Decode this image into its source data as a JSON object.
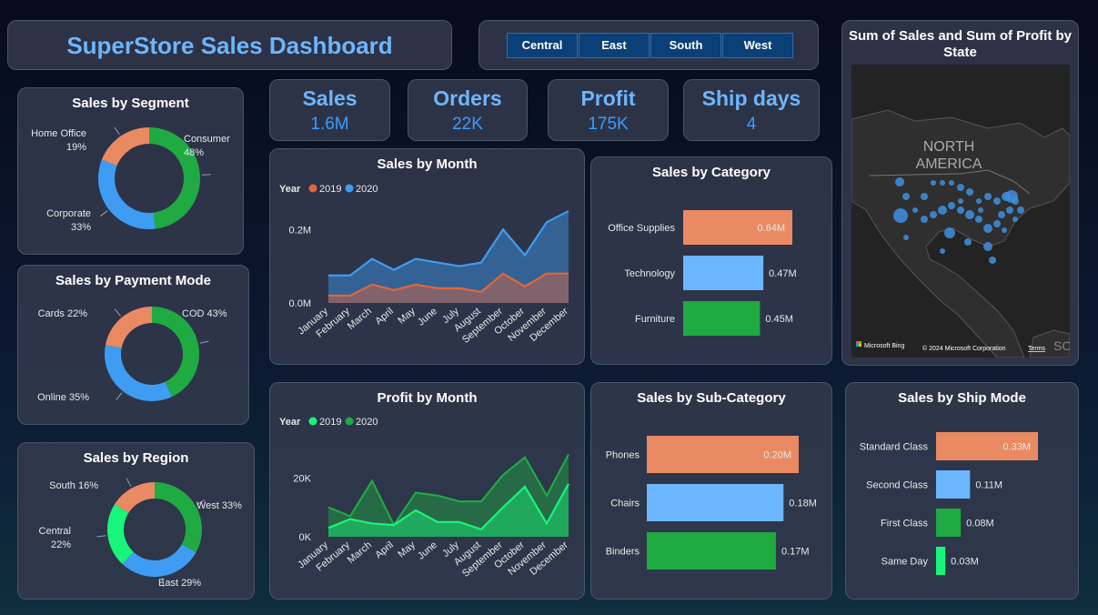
{
  "header": {
    "title": "SuperStore Sales Dashboard"
  },
  "slicer": {
    "options": [
      "Central",
      "East",
      "South",
      "West"
    ]
  },
  "kpis": [
    {
      "label": "Sales",
      "value": "1.6M"
    },
    {
      "label": "Orders",
      "value": "22K"
    },
    {
      "label": "Profit",
      "value": "175K"
    },
    {
      "label": "Ship days",
      "value": "4"
    }
  ],
  "colors": {
    "orange": "#ea8a62",
    "blue": "#6cb6ff",
    "green": "#1faa42",
    "bright_green": "#18f57a",
    "line_blue": "#3e9cf2",
    "line_orange": "#e0673c"
  },
  "map": {
    "title": "Sum of Sales and Sum of Profit by State",
    "region_label_1": "NORTH",
    "region_label_2": "AMERICA",
    "region_label_3": "SOU",
    "brand": "Microsoft Bing",
    "copyright": "© 2024 Microsoft Corporation",
    "terms": "Terms"
  },
  "chart_data": [
    {
      "id": "segment",
      "type": "pie",
      "title": "Sales by Segment",
      "categories": [
        "Consumer",
        "Corporate",
        "Home Office"
      ],
      "values": [
        48,
        33,
        19
      ],
      "labels": [
        "Consumer 48%",
        "Corporate 33%",
        "Home Office 19%"
      ],
      "colors": [
        "#1faa42",
        "#3e9cf2",
        "#ea8a62"
      ]
    },
    {
      "id": "payment",
      "type": "pie",
      "title": "Sales by Payment Mode",
      "categories": [
        "COD",
        "Online",
        "Cards"
      ],
      "values": [
        43,
        35,
        22
      ],
      "labels": [
        "COD 43%",
        "Online 35%",
        "Cards 22%"
      ],
      "colors": [
        "#1faa42",
        "#3e9cf2",
        "#ea8a62"
      ]
    },
    {
      "id": "region",
      "type": "pie",
      "title": "Sales by Region",
      "categories": [
        "West",
        "East",
        "Central",
        "South"
      ],
      "values": [
        33,
        29,
        22,
        16
      ],
      "labels": [
        "West 33%",
        "East 29%",
        "Central 22%",
        "South 16%"
      ],
      "colors": [
        "#1faa42",
        "#3e9cf2",
        "#18f57a",
        "#ea8a62"
      ]
    },
    {
      "id": "sales_month",
      "type": "area",
      "title": "Sales by Month",
      "legend_title": "Year",
      "categories": [
        "January",
        "February",
        "March",
        "April",
        "May",
        "June",
        "July",
        "August",
        "September",
        "October",
        "November",
        "December"
      ],
      "series": [
        {
          "name": "2019",
          "color": "#e0673c",
          "values": [
            0.02,
            0.02,
            0.05,
            0.035,
            0.05,
            0.04,
            0.04,
            0.03,
            0.08,
            0.045,
            0.08,
            0.08
          ]
        },
        {
          "name": "2020",
          "color": "#3e9cf2",
          "values": [
            0.075,
            0.075,
            0.12,
            0.09,
            0.12,
            0.11,
            0.1,
            0.11,
            0.2,
            0.13,
            0.22,
            0.25
          ]
        }
      ],
      "yticks": [
        "0.0M",
        "0.2M"
      ],
      "ylim": [
        0,
        0.27
      ]
    },
    {
      "id": "profit_month",
      "type": "area",
      "title": "Profit by Month",
      "legend_title": "Year",
      "categories": [
        "January",
        "February",
        "March",
        "April",
        "May",
        "June",
        "July",
        "August",
        "September",
        "October",
        "November",
        "December"
      ],
      "series": [
        {
          "name": "2019",
          "color": "#18f57a",
          "values": [
            3000,
            6000,
            4500,
            4000,
            9000,
            5000,
            5000,
            2500,
            10000,
            17000,
            4500,
            18000
          ]
        },
        {
          "name": "2020",
          "color": "#1faa42",
          "values": [
            10000,
            7000,
            19000,
            4000,
            15000,
            14000,
            12000,
            12000,
            21000,
            27000,
            14000,
            28000
          ]
        }
      ],
      "yticks": [
        "0K",
        "20K"
      ],
      "ylim": [
        0,
        30000
      ]
    },
    {
      "id": "category",
      "type": "bar",
      "title": "Sales by Category",
      "categories": [
        "Office Supplies",
        "Technology",
        "Furniture"
      ],
      "values": [
        0.64,
        0.47,
        0.45
      ],
      "labels": [
        "0.64M",
        "0.47M",
        "0.45M"
      ],
      "colors": [
        "#ea8a62",
        "#6cb6ff",
        "#1faa42"
      ]
    },
    {
      "id": "subcat",
      "type": "bar",
      "title": "Sales by Sub-Category",
      "categories": [
        "Phones",
        "Chairs",
        "Binders"
      ],
      "values": [
        0.2,
        0.18,
        0.17
      ],
      "labels": [
        "0.20M",
        "0.18M",
        "0.17M"
      ],
      "colors": [
        "#ea8a62",
        "#6cb6ff",
        "#1faa42"
      ]
    },
    {
      "id": "shipmode",
      "type": "bar",
      "title": "Sales by Ship Mode",
      "categories": [
        "Standard Class",
        "Second Class",
        "First Class",
        "Same Day"
      ],
      "values": [
        0.33,
        0.11,
        0.08,
        0.03
      ],
      "labels": [
        "0.33M",
        "0.11M",
        "0.08M",
        "0.03M"
      ],
      "colors": [
        "#ea8a62",
        "#6cb6ff",
        "#1faa42",
        "#18f57a"
      ]
    }
  ]
}
